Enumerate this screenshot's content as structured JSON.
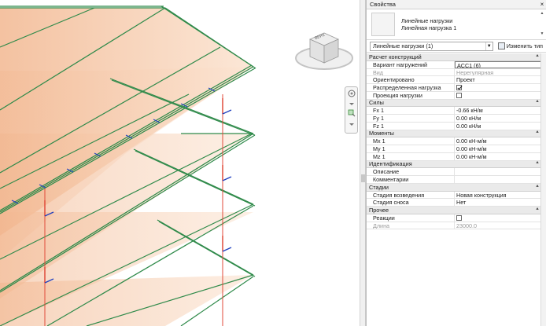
{
  "panel": {
    "title": "Свойства",
    "close": "×",
    "type_name_line1": "Линейные нагрузки",
    "type_name_line2": "Линейная нагрузка 1",
    "selector_value": "Линейные нагрузки (1)",
    "edit_type_label": "Изменить тип",
    "sections": [
      {
        "name": "Расчет конструкций",
        "rows": [
          {
            "label": "Вариант нагружений",
            "value": "ACC1 (6)",
            "state": "boxed"
          },
          {
            "label": "Вид",
            "value": "Нерегулярная",
            "state": "disabled"
          },
          {
            "label": "Ориентировано",
            "value": "Проект",
            "state": "normal"
          },
          {
            "label": "Распределенная нагрузка",
            "value": "",
            "checkbox": true,
            "checked": true
          },
          {
            "label": "Проекция нагрузки",
            "value": "",
            "checkbox": true,
            "checked": false
          }
        ]
      },
      {
        "name": "Силы",
        "rows": [
          {
            "label": "Fx 1",
            "value": "-0.66 кН/м",
            "state": "normal"
          },
          {
            "label": "Fy 1",
            "value": "0.00 кН/м",
            "state": "normal"
          },
          {
            "label": "Fz 1",
            "value": "0.00 кН/м",
            "state": "normal"
          }
        ]
      },
      {
        "name": "Моменты",
        "rows": [
          {
            "label": "Mx 1",
            "value": "0.00 кН-м/м",
            "state": "normal"
          },
          {
            "label": "My 1",
            "value": "0.00 кН-м/м",
            "state": "normal"
          },
          {
            "label": "Mz 1",
            "value": "0.00 кН-м/м",
            "state": "normal"
          }
        ]
      },
      {
        "name": "Идентификация",
        "rows": [
          {
            "label": "Описание",
            "value": "",
            "state": "normal"
          },
          {
            "label": "Комментарии",
            "value": "",
            "state": "normal"
          }
        ]
      },
      {
        "name": "Стадии",
        "rows": [
          {
            "label": "Стадия возведения",
            "value": "Новая конструкция",
            "state": "normal"
          },
          {
            "label": "Стадия сноса",
            "value": "Нет",
            "state": "normal"
          }
        ]
      },
      {
        "name": "Прочее",
        "rows": [
          {
            "label": "Реакции",
            "value": "",
            "checkbox": true,
            "checked": false
          },
          {
            "label": "Длина",
            "value": "23000.0",
            "state": "disabled"
          }
        ]
      }
    ]
  },
  "viewcube": {
    "face_label": "ВЕРХ"
  },
  "colors": {
    "slab_fill": "#f6c9a8",
    "beam_green": "#2f8a4a",
    "load_blue": "#1f3fbf",
    "column_red": "#e04a3a"
  }
}
